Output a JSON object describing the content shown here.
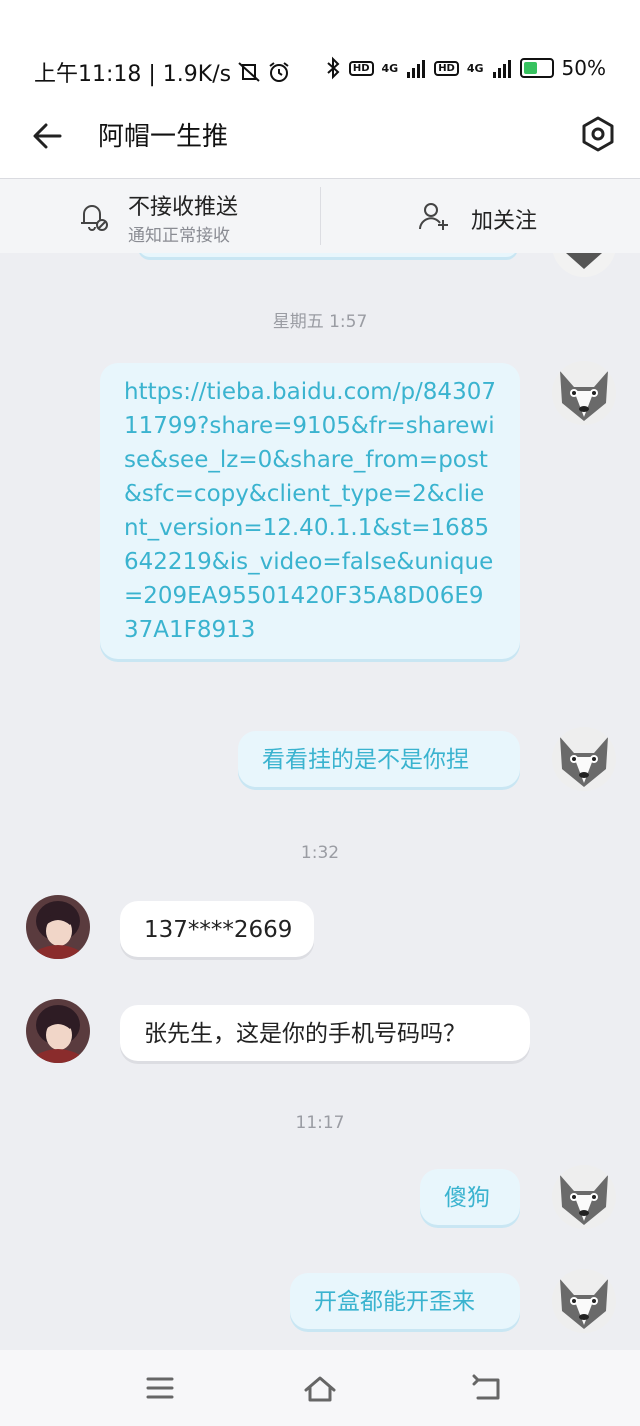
{
  "status_bar": {
    "time_info": "上午11:18 | 1.9K/s",
    "network_1": "4G",
    "network_2": "4G",
    "hd_1": "HD",
    "hd_2": "HD",
    "battery": "50%",
    "battery_level": 0.5
  },
  "header": {
    "title": "阿帽一生推"
  },
  "actions": {
    "push_title": "不接收推送",
    "push_subtitle": "通知正常接收",
    "follow_label": "加关注"
  },
  "chat": {
    "timestamps": [
      "星期五 1:57",
      "1:32",
      "11:17"
    ],
    "messages": [
      {
        "sender": "me",
        "text": "https://tieba.baidu.com/p/8430711799?share=9105&fr=sharewise&see_lz=0&share_from=post&sfc=copy&client_type=2&client_version=12.40.1.1&st=1685642219&is_video=false&unique=209EA95501420F35A8D06E937A1F8913"
      },
      {
        "sender": "me",
        "text": "看看挂的是不是你捏"
      },
      {
        "sender": "other",
        "text": "137****2669"
      },
      {
        "sender": "other",
        "text": "张先生，这是你的手机号码吗？"
      },
      {
        "sender": "me",
        "text": "傻狗"
      },
      {
        "sender": "me",
        "text": "开盒都能开歪来"
      }
    ]
  },
  "colors": {
    "accent": "#3ab3cf",
    "my_bubble": "#e8f6fc",
    "other_bubble": "#ffffff",
    "background": "#edeef2"
  },
  "icons": {
    "back": "back-arrow-icon",
    "settings": "settings-hexagon-icon",
    "bell": "bell-muted-icon",
    "follow": "add-user-icon",
    "menu": "menu-icon",
    "home": "home-icon",
    "back_nav": "back-nav-icon"
  }
}
